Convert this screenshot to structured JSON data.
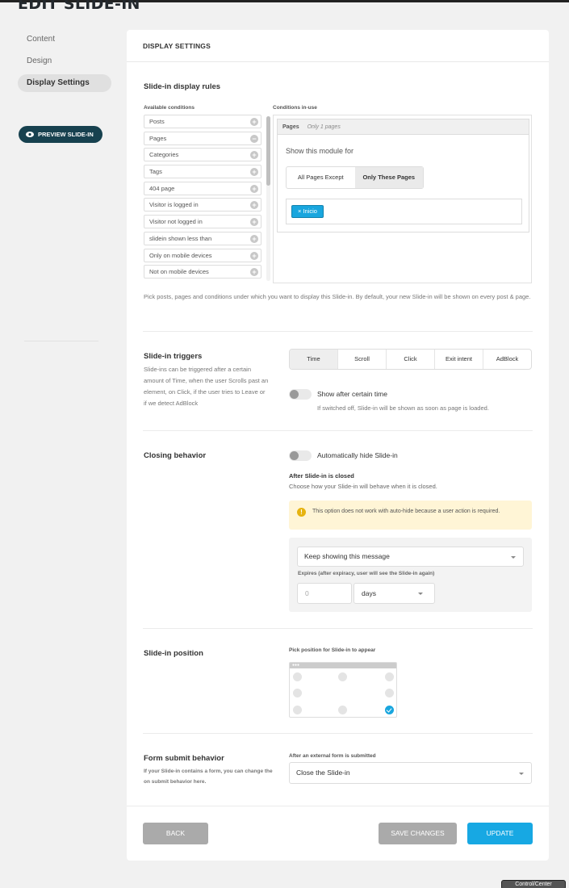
{
  "page_title": "EDIT SLIDE-IN",
  "sidebar": {
    "items": [
      {
        "label": "Content"
      },
      {
        "label": "Design"
      },
      {
        "label": "Display Settings"
      }
    ],
    "preview_label": "PREVIEW SLIDE-IN"
  },
  "card": {
    "header": "DISPLAY SETTINGS",
    "rules": {
      "title": "Slide-in display rules",
      "available_label": "Available conditions",
      "inuse_label": "Conditions in-use",
      "conditions": [
        "Posts",
        "Pages",
        "Categories",
        "Tags",
        "404 page",
        "Visitor is logged in",
        "Visitor not logged in",
        "slidein shown less than",
        "Only on mobile devices",
        "Not on mobile devices"
      ],
      "condition_marks": [
        "+",
        "−",
        "+",
        "+",
        "+",
        "+",
        "+",
        "+",
        "+",
        "+"
      ],
      "panel_title": "Pages",
      "panel_subtitle": "Only 1 pages",
      "show_for": "Show this module for",
      "options": [
        "All Pages Except",
        "Only These Pages"
      ],
      "tag": "× Inicio",
      "help": "Pick posts, pages and conditions under which you want to display this Slide-in. By default, your new Slide-in will be shown on every post & page."
    },
    "triggers": {
      "title": "Slide-in triggers",
      "desc": "Slide-ins can be triggered after a certain amount of Time, when the user Scrolls past an element, on Click, if the user tries to Leave or if we detect AdBlock",
      "tabs": [
        "Time",
        "Scroll",
        "Click",
        "Exit intent",
        "AdBlock"
      ],
      "active_tab": "Time",
      "toggle_label": "Show after certain time",
      "toggle_help": "If switched off, Slide-in will be shown as soon as page is loaded."
    },
    "closing": {
      "title": "Closing behavior",
      "toggle_label": "Automatically hide Slide-in",
      "after_title": "After Slide-in is closed",
      "after_desc": "Choose how your Slide-in will behave when it is closed.",
      "notice": "This option does not work with auto-hide because a user action is required.",
      "behavior_value": "Keep showing this message",
      "expires_label": "Expires (after expiracy, user will see the Slide-in again)",
      "expires_placeholder": "0",
      "unit_value": "days"
    },
    "position": {
      "title": "Slide-in position",
      "label": "Pick position for Slide-in to appear",
      "selected": "bottom-right"
    },
    "form_submit": {
      "title": "Form submit behavior",
      "desc": "If your Slide-in contains a form, you can change the on submit behavior here.",
      "label": "After an external form is submitted",
      "value": "Close the Slide-in"
    },
    "buttons": {
      "back": "BACK",
      "save": "SAVE CHANGES",
      "update": "UPDATE"
    }
  },
  "corner_label": "Control/Center"
}
